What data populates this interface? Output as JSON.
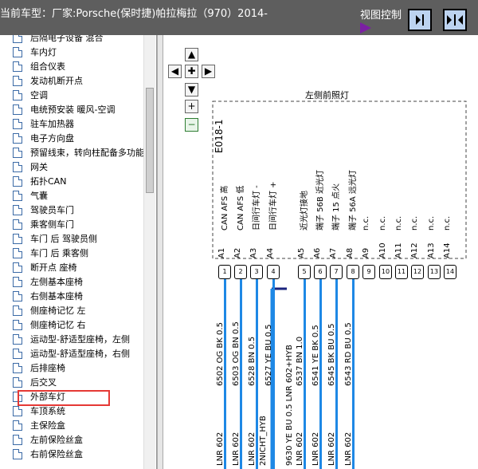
{
  "header": {
    "title": "当前车型：厂家:Porsche(保时捷)帕拉梅拉（970）2014-",
    "view_control_label": "视图控制"
  },
  "sidebar": {
    "selected_index": 26,
    "items": [
      {
        "label": "后隔电子设备 混合"
      },
      {
        "label": "车内灯"
      },
      {
        "label": "组合仪表"
      },
      {
        "label": "发动机断开点"
      },
      {
        "label": "空调"
      },
      {
        "label": "电统预安装 暖风-空调"
      },
      {
        "label": "驻车加热器"
      },
      {
        "label": "电子方向盘"
      },
      {
        "label": "预留线束，转向柱配备多功能"
      },
      {
        "label": "网关"
      },
      {
        "label": "拓扑CAN"
      },
      {
        "label": "气囊"
      },
      {
        "label": "驾驶员车门"
      },
      {
        "label": "乘客侧车门"
      },
      {
        "label": "车门 后 驾驶员侧"
      },
      {
        "label": "车门 后 乘客侧"
      },
      {
        "label": "断开点 座椅"
      },
      {
        "label": "左侧基本座椅"
      },
      {
        "label": "右侧基本座椅"
      },
      {
        "label": "侧座椅记忆 左"
      },
      {
        "label": "侧座椅记忆 右"
      },
      {
        "label": "运动型-舒适型座椅，左侧"
      },
      {
        "label": "运动型-舒适型座椅，右侧"
      },
      {
        "label": "后排座椅"
      },
      {
        "label": "后交叉"
      },
      {
        "label": "外部车灯"
      },
      {
        "label": "车顶系统"
      },
      {
        "label": "主保险盒"
      },
      {
        "label": "左前保险丝盒"
      },
      {
        "label": "右前保险丝盒"
      }
    ]
  },
  "nav": {
    "up": "▲",
    "left": "◀",
    "center": "✚",
    "right": "▶",
    "down": "▼",
    "zoom_in": "+",
    "zoom_out": "−"
  },
  "diagram": {
    "component_title": "左侧前照灯",
    "component_code": "E018-1",
    "pins": [
      {
        "pin": "A1",
        "func": "CAN AFS 高",
        "num": "1",
        "wire_code": "6502 OG BK 0.5",
        "harness": "LNR 602",
        "wired": true
      },
      {
        "pin": "A2",
        "func": "CAN AFS 低",
        "num": "2",
        "wire_code": "6503 OG BN 0.5",
        "harness": "LNR 602",
        "wired": true
      },
      {
        "pin": "A3",
        "func": "日间行车灯 -",
        "num": "3",
        "wire_code": "6528 BN 0.5",
        "harness": "LNR 602",
        "wired": true
      },
      {
        "pin": "A4",
        "func": "日间行车灯 +",
        "num": "4",
        "wire_code": "6527 YE BU 0.5",
        "harness": "2NICHT_HYB",
        "wired": true
      },
      {
        "pin": "A5",
        "func": "近光灯接地",
        "num": "5",
        "wire_code": "6537 BN 1.0",
        "harness": "LNR 602",
        "wired": true
      },
      {
        "pin": "A6",
        "func": "端子 56B 近光灯",
        "num": "6",
        "wire_code": "6541 YE BK 0.5",
        "harness": "LNR 602",
        "wired": true
      },
      {
        "pin": "A7",
        "func": "端子 15 点火",
        "num": "7",
        "wire_code": "6545 BK BU 0.5",
        "harness": "LNR 602",
        "wired": true
      },
      {
        "pin": "A8",
        "func": "端子 56A 远光灯",
        "num": "8",
        "wire_code": "6543 RD BU 0.5",
        "harness": "LNR 602",
        "wired": true
      },
      {
        "pin": "A9",
        "func": "n.c.",
        "num": "9",
        "wired": false
      },
      {
        "pin": "A10",
        "func": "n.c.",
        "num": "10",
        "wired": false
      },
      {
        "pin": "A11",
        "func": "n.c.",
        "num": "11",
        "wired": false
      },
      {
        "pin": "A12",
        "func": "n.c.",
        "num": "12",
        "wired": false
      },
      {
        "pin": "A13",
        "func": "n.c.",
        "num": "13",
        "wired": false
      },
      {
        "pin": "A14",
        "func": "n.c.",
        "num": "14",
        "wired": false
      }
    ],
    "extra_wire": {
      "wire_code": "9630 YE BU 0.5",
      "harness": "LNR 602+HYB"
    }
  }
}
